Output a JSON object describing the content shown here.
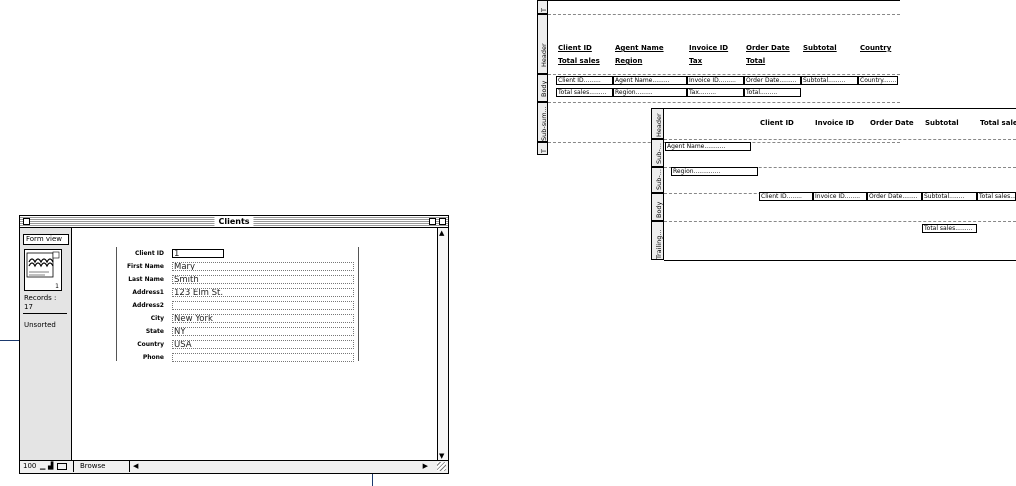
{
  "clients_window": {
    "title": "Clients",
    "view_button": "Form view",
    "records_label": "Records :",
    "records_count": "17",
    "sort_status": "Unsorted",
    "zoom": "100",
    "mode": "Browse",
    "book_page": "1",
    "fields": [
      {
        "label": "Client ID",
        "value": "1"
      },
      {
        "label": "First Name",
        "value": "Mary"
      },
      {
        "label": "Last Name",
        "value": "Smith"
      },
      {
        "label": "Address1",
        "value": "123 Elm St."
      },
      {
        "label": "Address2",
        "value": ""
      },
      {
        "label": "City",
        "value": "New York"
      },
      {
        "label": "State",
        "value": "NY"
      },
      {
        "label": "Country",
        "value": "USA"
      },
      {
        "label": "Phone",
        "value": ""
      }
    ]
  },
  "layout_top": {
    "parts": [
      "T",
      "Header",
      "Body",
      "Sub-sum...",
      "T"
    ],
    "header_row1": [
      "Client ID",
      "Agent Name",
      "Invoice ID",
      "Order Date",
      "Subtotal",
      "Country"
    ],
    "header_row2": [
      "Total sales",
      "Region",
      "Tax",
      "Total"
    ],
    "body_row1": [
      "Client ID",
      "Agent Name",
      "Invoice ID",
      "Order Date",
      "Subtotal",
      "Country"
    ],
    "body_row2": [
      "Total sales",
      "Region",
      "Tax",
      "Total"
    ]
  },
  "layout_bottom": {
    "parts": [
      "Header",
      "Sub-...",
      "Sub-...",
      "Body",
      "Trailing..."
    ],
    "header_labels": [
      "Client ID",
      "Invoice ID",
      "Order Date",
      "Subtotal",
      "Total sales"
    ],
    "agent_field": "Agent Name",
    "region_field": "Region",
    "body_fields": [
      "Client ID",
      "Invoice ID",
      "Order Date",
      "Subtotal",
      "Total sales"
    ],
    "trailing_field": "Total sales"
  }
}
